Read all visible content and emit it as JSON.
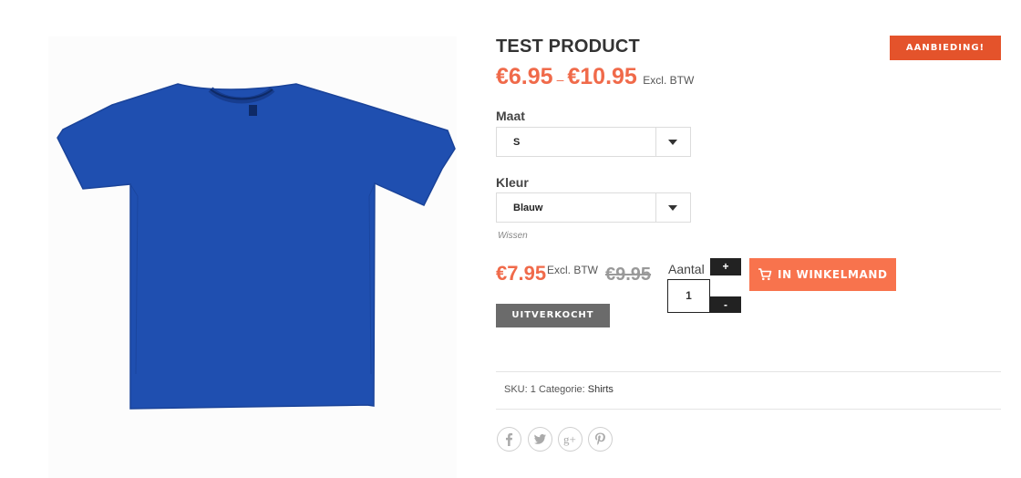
{
  "product": {
    "title": "TEST PRODUCT",
    "sale_badge": "AANBIEDING!",
    "price_min": "€6.95",
    "price_sep": "–",
    "price_max": "€10.95",
    "price_suffix": "Excl. BTW"
  },
  "variations": {
    "size_label": "Maat",
    "size_value": "S",
    "color_label": "Kleur",
    "color_value": "Blauw",
    "reset_link": "Wissen"
  },
  "variation_price": {
    "price": "€7.95",
    "suffix": "Excl. BTW",
    "old_price": "€9.95",
    "stock_status": "UITVERKOCHT"
  },
  "quantity": {
    "label": "Aantal",
    "value": "1",
    "plus": "+",
    "minus": "-"
  },
  "add_to_cart": {
    "label": "IN WINKELMAND",
    "icon": "cart-icon"
  },
  "meta": {
    "sku_label": "SKU:",
    "sku_value": "1",
    "category_label": "Categorie:",
    "category_value": "Shirts"
  },
  "share": [
    "facebook-icon",
    "twitter-icon",
    "google-plus-icon",
    "pinterest-icon"
  ],
  "colors": {
    "accent": "#f06a4a",
    "badge": "#e4532b",
    "cart_button": "#f8734d",
    "shirt": "#1f4fb0",
    "soldout": "#6b6b6b"
  }
}
